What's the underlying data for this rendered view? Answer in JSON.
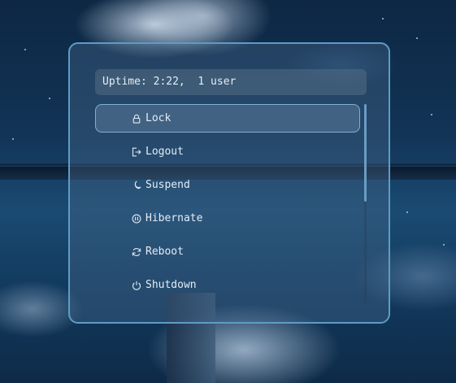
{
  "uptime": {
    "text": "Uptime: 2:22,  1 user"
  },
  "menu": {
    "items": [
      {
        "label": "Lock",
        "icon": "lock-icon",
        "selected": true
      },
      {
        "label": "Logout",
        "icon": "logout-icon",
        "selected": false
      },
      {
        "label": "Suspend",
        "icon": "moon-icon",
        "selected": false
      },
      {
        "label": "Hibernate",
        "icon": "hibernate-icon",
        "selected": false
      },
      {
        "label": "Reboot",
        "icon": "reboot-icon",
        "selected": false
      },
      {
        "label": "Shutdown",
        "icon": "power-icon",
        "selected": false
      }
    ]
  },
  "colors": {
    "accent_border": "#5f9bc6",
    "text": "#e4ecf5",
    "selected_border": "#7fb0d4"
  }
}
